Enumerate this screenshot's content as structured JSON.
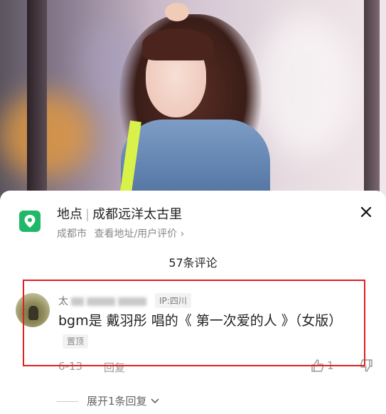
{
  "photo": {
    "description_icon": "photo-background"
  },
  "location": {
    "icon": "location-pin-icon",
    "label": "地点",
    "name": "成都远洋太古里",
    "city": "成都市",
    "link": "查看地址/用户评价",
    "accent": "#1fb868"
  },
  "close_icon": "close-icon",
  "comments": {
    "count_label": "57条评论",
    "items": [
      {
        "username_first_char": "太",
        "ip": "IP:四川",
        "text": "bgm是  戴羽彤 唱的《 第一次爱的人 》（女版）",
        "pinned_label": "置顶",
        "date": "6-13",
        "reply_label": "回复",
        "likes": "1"
      }
    ],
    "expand_label": "展开1条回复"
  },
  "highlight_color": "#e02020"
}
